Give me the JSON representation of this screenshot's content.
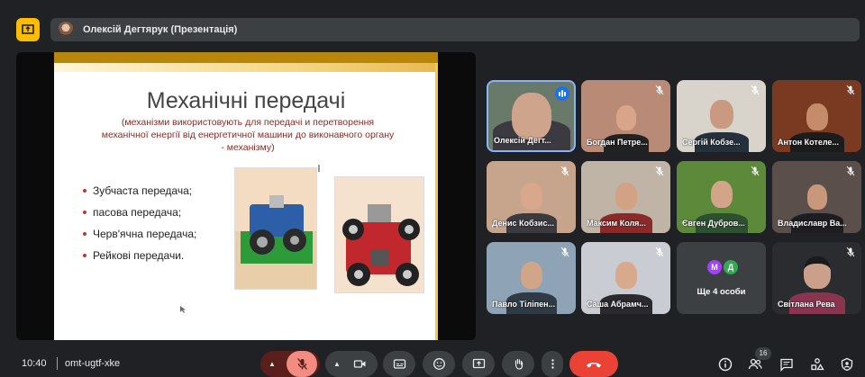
{
  "topbar": {
    "presenter_name": "Олексій Дегтярук (Презентація)"
  },
  "slide": {
    "title": "Механічні передачі",
    "subtitle_line1": "(механізми використовують для передачі и перетворення",
    "subtitle_line2": "механічної енергії від енергетичної  машини до виконавчого органу",
    "subtitle_line3": "- механізму)",
    "bullets": [
      "Зубчаста передача;",
      "пасова передача;",
      "Черв'ячна передача;",
      "Рейкові передачи."
    ]
  },
  "participants": [
    {
      "name": "Олексій Дегт...",
      "speaking": true
    },
    {
      "name": "Богдан Петре...",
      "muted": true
    },
    {
      "name": "Сергій Кобзе...",
      "muted": true
    },
    {
      "name": "Антон Котеле...",
      "muted": true
    },
    {
      "name": "Денис Кобзис...",
      "muted": true
    },
    {
      "name": "Максим Коля...",
      "muted": true
    },
    {
      "name": "Євген Дубров...",
      "muted": true
    },
    {
      "name": "Владиславр Ва...",
      "muted": true
    },
    {
      "name": "Павло Тіліпен...",
      "muted": true
    },
    {
      "name": "Саша Абрамч...",
      "muted": true
    },
    {
      "name": "Ще 4 особи",
      "initials": [
        "М",
        "Д"
      ]
    },
    {
      "name": "Світлана Рева",
      "muted": true
    }
  ],
  "bottombar": {
    "time": "10:40",
    "meeting_code": "omt-ugtf-xke",
    "people_count": "16"
  },
  "colors": {
    "accent": "#8ab4f8",
    "hangup": "#ea4335",
    "mic_off": "#f28b82",
    "present": "#fbbc04"
  }
}
